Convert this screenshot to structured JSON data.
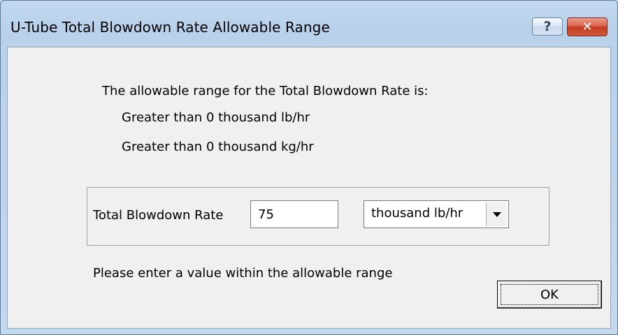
{
  "window": {
    "title": "U-Tube Total Blowdown Rate Allowable Range",
    "help_label": "?",
    "close_label": "✕"
  },
  "info": {
    "heading": "The allowable range for the Total Blowdown Rate is:",
    "range_english": "Greater than 0 thousand lb/hr",
    "range_metric": "Greater than 0 thousand kg/hr"
  },
  "input": {
    "label": "Total Blowdown Rate",
    "value": "75",
    "unit_selected": "thousand lb/hr"
  },
  "message": "Please enter a value within the allowable range",
  "ok_label": "OK",
  "colors": {
    "title_bar": "#b9d1ea",
    "client_bg": "#f0f0f0",
    "close_button": "#c23a22"
  },
  "icons": {
    "help": "question-icon",
    "close": "close-icon",
    "dropdown": "chevron-down-icon"
  }
}
